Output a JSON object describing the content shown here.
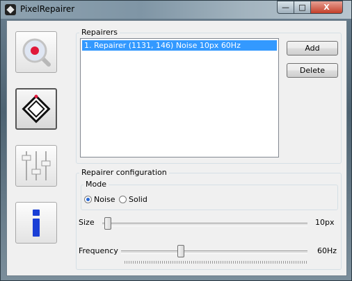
{
  "window": {
    "title": "PixelRepairer",
    "controls": {
      "minimize": "—",
      "maximize": "□",
      "close": "X"
    }
  },
  "sidebar": {
    "items": [
      {
        "name": "magnifier-icon"
      },
      {
        "name": "repair-diamond-icon"
      },
      {
        "name": "sliders-icon"
      },
      {
        "name": "info-icon"
      }
    ],
    "active_index": 1
  },
  "repairers": {
    "group_label": "Repairers",
    "items": [
      "1. Repairer (1131, 146) Noise 10px 60Hz"
    ],
    "selected_index": 0,
    "add_label": "Add",
    "delete_label": "Delete"
  },
  "config": {
    "group_label": "Repairer configuration",
    "mode": {
      "label": "Mode",
      "options": [
        "Noise",
        "Solid"
      ],
      "selected": "Noise"
    },
    "size": {
      "label": "Size",
      "value_text": "10px",
      "fraction": 0.0
    },
    "frequency": {
      "label": "Frequency",
      "value_text": "60Hz",
      "fraction": 0.31
    }
  }
}
